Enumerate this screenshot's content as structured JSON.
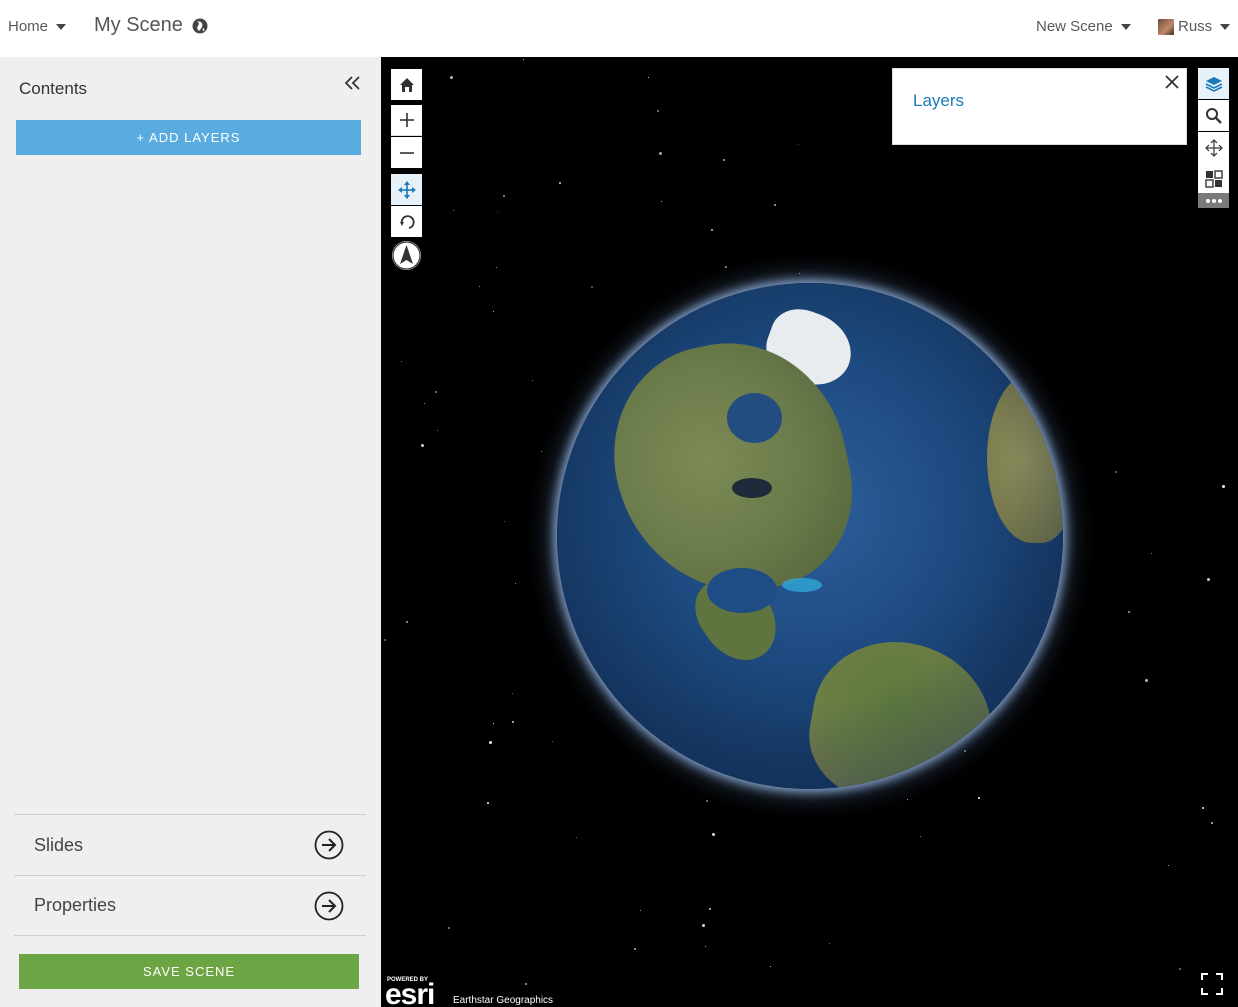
{
  "topbar": {
    "home_label": "Home",
    "scene_title": "My Scene",
    "new_scene_label": "New Scene",
    "user_name": "Russ"
  },
  "sidebar": {
    "contents_title": "Contents",
    "add_layers_label": "+ ADD LAYERS",
    "rows": [
      {
        "label": "Slides"
      },
      {
        "label": "Properties"
      }
    ],
    "save_label": "SAVE SCENE"
  },
  "map": {
    "layers_panel_title": "Layers",
    "powered_by": "POWERED BY",
    "esri_logo": "esri",
    "attribution": "Earthstar Geographics",
    "colors": {
      "accent": "#1c7ab8",
      "add_layers_bg": "#5aace0",
      "save_bg": "#6ba544",
      "space": "#000000"
    },
    "icons": [
      "home-icon",
      "zoom-in-icon",
      "zoom-out-icon",
      "pan-icon",
      "rotate-icon",
      "compass-icon",
      "layers-icon",
      "search-icon",
      "move-icon",
      "grid-icon",
      "more-icon",
      "fullscreen-icon",
      "close-icon",
      "globe-icon",
      "double-chevron-left-icon",
      "arrow-right-circle-icon"
    ]
  }
}
